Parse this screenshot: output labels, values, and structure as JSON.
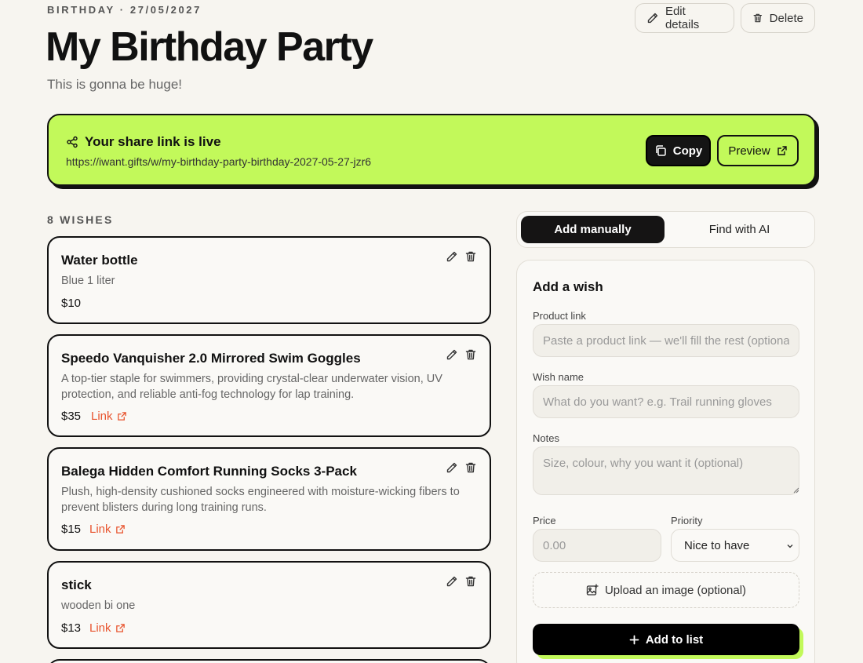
{
  "event": {
    "eyebrow": "BIRTHDAY · 27/05/2027",
    "title": "My Birthday Party",
    "subtitle": "This is gonna be huge!"
  },
  "header_actions": {
    "edit_label": "Edit details",
    "delete_label": "Delete"
  },
  "share": {
    "heading": "Your share link is live",
    "url": "https://iwant.gifts/w/my-birthday-party-birthday-2027-05-27-jzr6",
    "copy_label": "Copy",
    "preview_label": "Preview"
  },
  "wishes": {
    "count_label": "8 WISHES",
    "items": [
      {
        "name": "Water bottle",
        "notes": "Blue 1 liter",
        "price": "$10",
        "link_label": ""
      },
      {
        "name": "Speedo Vanquisher 2.0 Mirrored Swim Goggles",
        "notes": "A top-tier staple for swimmers, providing crystal-clear underwater vision, UV protection, and reliable anti-fog technology for lap training.",
        "price": "$35",
        "link_label": "Link"
      },
      {
        "name": "Balega Hidden Comfort Running Socks 3-Pack",
        "notes": "Plush, high-density cushioned socks engineered with moisture-wicking fibers to prevent blisters during long training runs.",
        "price": "$15",
        "link_label": "Link"
      },
      {
        "name": "stick",
        "notes": "wooden bi one",
        "price": "$13",
        "link_label": "Link"
      }
    ]
  },
  "tabs": {
    "manual_label": "Add manually",
    "ai_label": "Find with AI"
  },
  "form": {
    "title": "Add a wish",
    "product_link_label": "Product link",
    "product_link_placeholder": "Paste a product link — we'll fill the rest (optional)",
    "wish_name_label": "Wish name",
    "wish_name_placeholder": "What do you want? e.g. Trail running gloves",
    "notes_label": "Notes",
    "notes_placeholder": "Size, colour, why you want it (optional)",
    "price_label": "Price",
    "price_placeholder": "0.00",
    "priority_label": "Priority",
    "priority_value": "Nice to have",
    "upload_label": "Upload an image (optional)",
    "add_label": "Add to list"
  },
  "colors": {
    "accent_lime": "#c2f95a",
    "link_orange": "#e8542e",
    "background": "#f7f5f0"
  },
  "icons": {
    "edit": "pencil-icon",
    "delete": "trash-icon",
    "share": "share-icon",
    "copy": "copy-icon",
    "external": "external-link-icon",
    "image": "image-icon",
    "plus": "plus-icon",
    "chevron": "chevron-down-icon"
  }
}
